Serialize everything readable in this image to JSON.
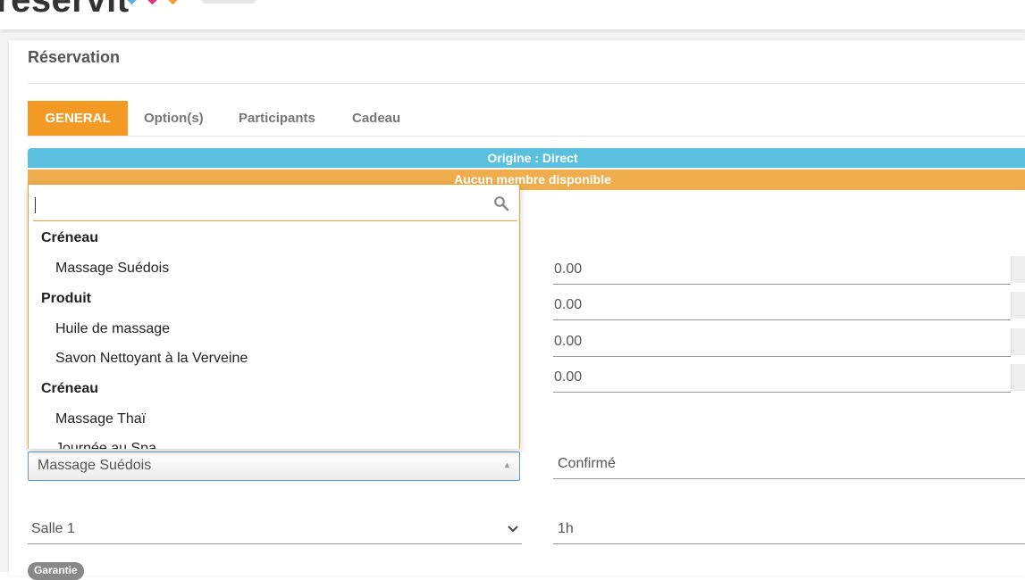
{
  "header": {
    "logo_text": "reservit",
    "logo_icon": "reservit-logo-hearts"
  },
  "page": {
    "title": "Réservation"
  },
  "tabs": [
    {
      "label": "GENERAL",
      "active": true
    },
    {
      "label": "Option(s)",
      "active": false
    },
    {
      "label": "Participants",
      "active": false
    },
    {
      "label": "Cadeau",
      "active": false
    }
  ],
  "banners": {
    "origin": "Origine : Direct",
    "availability": "Aucun membre disponible"
  },
  "amounts": [
    "0.00",
    "0.00",
    "0.00",
    "0.00"
  ],
  "service_select": {
    "value": "Massage Suédois"
  },
  "dropdown": {
    "search_value": "",
    "groups": [
      {
        "label": "Créneau",
        "items": [
          "Massage Suédois"
        ]
      },
      {
        "label": "Produit",
        "items": [
          "Huile de massage",
          "Savon Nettoyant à la Verveine"
        ]
      },
      {
        "label": "Créneau",
        "items": [
          "Massage Thaï",
          "Journée au Spa"
        ]
      }
    ]
  },
  "status": {
    "value": "Confirmé"
  },
  "room_select": {
    "value": "Salle 1"
  },
  "duration": {
    "value": "1h"
  },
  "badge": {
    "label": "Garantie"
  },
  "colors": {
    "accent_orange": "#f39a24",
    "banner_blue": "#5bc0de",
    "banner_orange": "#f0ad4e",
    "focus_blue": "#5b9bd5"
  }
}
